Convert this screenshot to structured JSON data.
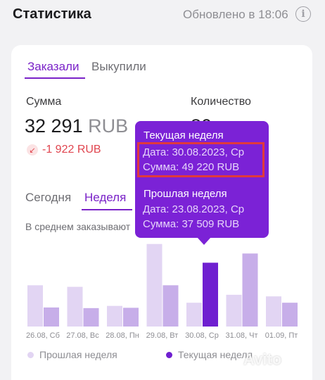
{
  "header": {
    "title": "Статистика",
    "updated": "Обновлено в 18:06",
    "info_icon": "i"
  },
  "tabs": {
    "orders": "Заказали",
    "bought": "Выкупили"
  },
  "summary": {
    "sum_label": "Сумма",
    "sum_value": "32 291",
    "sum_currency": "RUB",
    "delta": "-1 922 RUB",
    "qty_label": "Количество",
    "qty_value": "80"
  },
  "period": {
    "today": "Сегодня",
    "week": "Неделя"
  },
  "avg_text": "В среднем заказывают",
  "tooltip": {
    "current_title": "Текущая неделя",
    "current_date": "Дата: 30.08.2023, Ср",
    "current_sum": "Сумма: 49 220 RUB",
    "prev_title": "Прошлая неделя",
    "prev_date": "Дата: 23.08.2023, Ср",
    "prev_sum": "Сумма: 37 509 RUB"
  },
  "legend": {
    "prev": "Прошлая неделя",
    "current": "Текущая неделя"
  },
  "colors": {
    "accent": "#7a22c8",
    "prev_bar": "#e2d5f3",
    "current_bar": "#c7aee9",
    "selected_bar": "#6f1fd0",
    "negative": "#e0454f"
  },
  "watermark": "Avito",
  "chart_data": {
    "type": "bar",
    "categories": [
      "26.08, Сб",
      "27.08, Вс",
      "28.08, Пн",
      "29.08, Вт",
      "30.08, Ср",
      "31.08, Чт",
      "01.09, Пт"
    ],
    "series": [
      {
        "name": "Прошлая неделя",
        "values": [
          13000,
          12500,
          6500,
          26000,
          7500,
          10000,
          9500
        ]
      },
      {
        "name": "Текущая неделя",
        "values": [
          6000,
          5800,
          5900,
          13000,
          20100,
          23000,
          7500
        ]
      }
    ],
    "selected_index": 4
  }
}
